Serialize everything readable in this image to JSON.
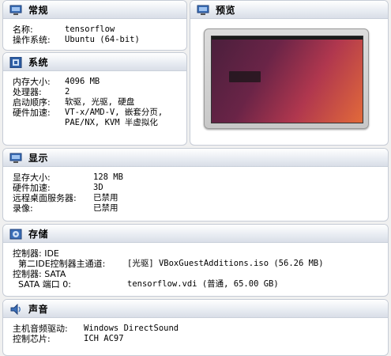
{
  "general": {
    "title": "常规",
    "rows": [
      {
        "label": "名称:",
        "value": "tensorflow"
      },
      {
        "label": "操作系统:",
        "value": "Ubuntu (64-bit)"
      }
    ]
  },
  "preview": {
    "title": "预览"
  },
  "system": {
    "title": "系统",
    "rows": [
      {
        "label": "内存大小:",
        "value": "4096 MB"
      },
      {
        "label": "处理器:",
        "value": "2"
      },
      {
        "label": "启动顺序:",
        "value": "软驱, 光驱, 硬盘"
      },
      {
        "label": "硬件加速:",
        "value": "VT-x/AMD-V, 嵌套分页,"
      },
      {
        "label": "",
        "value": "PAE/NX, KVM 半虚拟化"
      }
    ]
  },
  "display": {
    "title": "显示",
    "rows": [
      {
        "label": "显存大小:",
        "value": "128 MB"
      },
      {
        "label": "硬件加速:",
        "value": "3D"
      },
      {
        "label": "远程桌面服务器:",
        "value": "已禁用"
      },
      {
        "label": "录像:",
        "value": "已禁用"
      }
    ]
  },
  "storage": {
    "title": "存储",
    "rows": [
      {
        "label": "控制器: IDE",
        "value": ""
      },
      {
        "label": "  第二IDE控制器主通道:",
        "value": "[光驱] VBoxGuestAdditions.iso (56.26 MB)"
      },
      {
        "label": "控制器: SATA",
        "value": ""
      },
      {
        "label": "  SATA 端口 0:",
        "value": "tensorflow.vdi (普通, 65.00 GB)"
      }
    ]
  },
  "audio": {
    "title": "声音",
    "rows": [
      {
        "label": "主机音频驱动:",
        "value": "Windows DirectSound"
      },
      {
        "label": "控制芯片:",
        "value": "ICH AC97"
      }
    ]
  }
}
